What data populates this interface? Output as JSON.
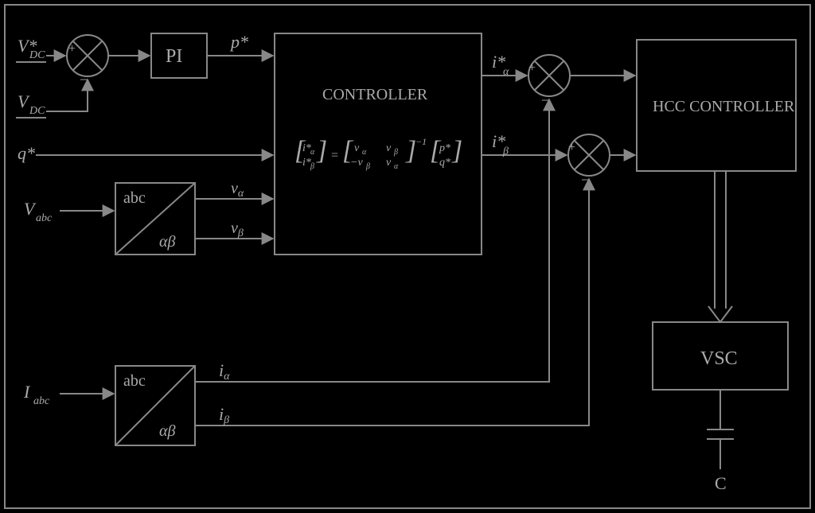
{
  "signals": {
    "vdc_ref": "V*",
    "vdc_ref_sub": "DC",
    "vdc": "V",
    "vdc_sub": "DC",
    "q_ref": "q*",
    "vabc": "V",
    "vabc_sub": "abc",
    "iabc": "I",
    "iabc_sub": "abc",
    "p_ref": "p*",
    "va": "v",
    "va_sub": "α",
    "vb": "v",
    "vb_sub": "β",
    "ia_ref": "i*",
    "ia_ref_sub": "α",
    "ib_ref": "i*",
    "ib_ref_sub": "β",
    "ia": "i",
    "ia_sub": "α",
    "ib": "i",
    "ib_sub": "β",
    "cap": "C"
  },
  "blocks": {
    "pi": "PI",
    "controller": "CONTROLLER",
    "hcc": "HCC CONTROLLER",
    "vsc": "VSC",
    "abc": "abc",
    "ab": "αβ"
  },
  "equation": {
    "lhs_top": "i*",
    "lhs_top_sub": "α",
    "lhs_bot": "i*",
    "lhs_bot_sub": "β",
    "eq": "=",
    "m11": "v",
    "m11_sub": "α",
    "m12": "v",
    "m12_sub": "β",
    "m21": "−v",
    "m21_sub": "β",
    "m22": "v",
    "m22_sub": "α",
    "inv": "−1",
    "rhs_top": "p*",
    "rhs_bot": "q*"
  },
  "sum": {
    "plus": "+",
    "minus": "−"
  }
}
